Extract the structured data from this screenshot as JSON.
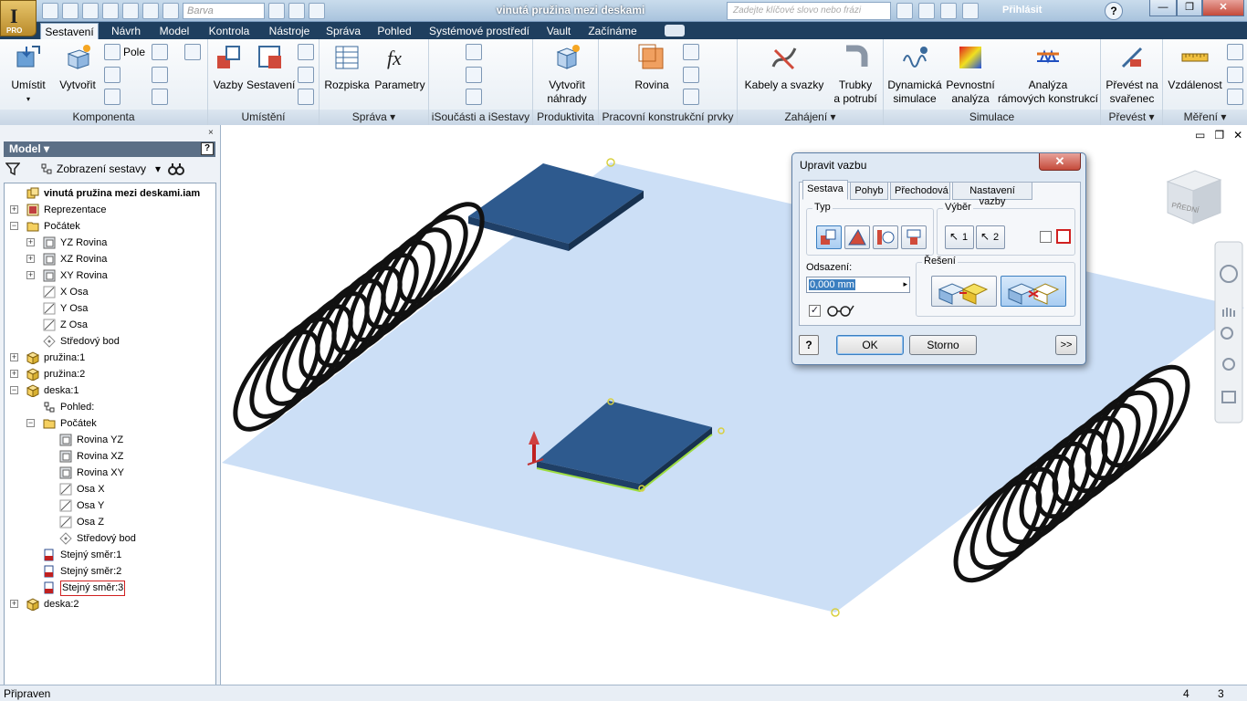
{
  "window": {
    "title": "vinutá pružina mezi deskami",
    "app_logo_text": "I",
    "app_badge": "PRO",
    "material_placeholder": "Barva",
    "search_placeholder": "Zadejte klíčové slovo nebo frázi",
    "signin": "Přihlásit",
    "help": "?"
  },
  "ribbon_tabs": [
    "Sestavení",
    "Návrh",
    "Model",
    "Kontrola",
    "Nástroje",
    "Správa",
    "Pohled",
    "Systémové prostředí",
    "Vault",
    "Začínáme"
  ],
  "ribbon": {
    "komponenta": {
      "label": "Komponenta",
      "umistit": "Umístit",
      "vytvorit": "Vytvořit",
      "pole": "Pole"
    },
    "umisteni": {
      "label": "Umístění",
      "vazby": "Vazby",
      "sestaveni": "Sestavení"
    },
    "sprava": {
      "label": "Správa",
      "rozpiska": "Rozpiska",
      "parametry": "Parametry"
    },
    "isoucasti": {
      "label": "iSoučásti a iSestavy"
    },
    "produktivita": {
      "label": "Produktivita",
      "vytvorit_nahrady_1": "Vytvořit",
      "vytvorit_nahrady_2": "náhrady"
    },
    "pracovni": {
      "label": "Pracovní konstrukční prvky",
      "rovina": "Rovina"
    },
    "zahajeni": {
      "label": "Zahájení",
      "kabely": "Kabely a svazky",
      "trubky_1": "Trubky",
      "trubky_2": "a potrubí"
    },
    "simulace": {
      "label": "Simulace",
      "dyn_1": "Dynamická",
      "dyn_2": "simulace",
      "pev_1": "Pevnostní",
      "pev_2": "analýza",
      "ana_1": "Analýza",
      "ana_2": "rámových konstrukcí"
    },
    "prevest": {
      "label": "Převést",
      "pn_1": "Převést na",
      "pn_2": "svařenec"
    },
    "mereni": {
      "label": "Měření",
      "vzdalenost": "Vzdálenost"
    }
  },
  "browser": {
    "title": "Model",
    "view": "Zobrazení sestavy",
    "close": "×",
    "help": "?",
    "tree": [
      {
        "text": "vinutá pružina mezi deskami.iam",
        "level": 0,
        "exp": "",
        "icon": "assembly",
        "bold": true
      },
      {
        "text": "Reprezentace",
        "level": 0,
        "exp": "+",
        "icon": "representations"
      },
      {
        "text": "Počátek",
        "level": 0,
        "exp": "−",
        "icon": "folder"
      },
      {
        "text": "YZ Rovina",
        "level": 1,
        "exp": "+",
        "icon": "plane"
      },
      {
        "text": "XZ Rovina",
        "level": 1,
        "exp": "+",
        "icon": "plane"
      },
      {
        "text": "XY Rovina",
        "level": 1,
        "exp": "+",
        "icon": "plane"
      },
      {
        "text": "X Osa",
        "level": 1,
        "exp": "",
        "icon": "axis"
      },
      {
        "text": "Y Osa",
        "level": 1,
        "exp": "",
        "icon": "axis"
      },
      {
        "text": "Z Osa",
        "level": 1,
        "exp": "",
        "icon": "axis"
      },
      {
        "text": "Středový bod",
        "level": 1,
        "exp": "",
        "icon": "point"
      },
      {
        "text": "pružina:1",
        "level": 0,
        "exp": "+",
        "icon": "part"
      },
      {
        "text": "pružina:2",
        "level": 0,
        "exp": "+",
        "icon": "part"
      },
      {
        "text": "deska:1",
        "level": 0,
        "exp": "−",
        "icon": "part"
      },
      {
        "text": "Pohled:",
        "level": 1,
        "exp": "",
        "icon": "view"
      },
      {
        "text": "Počátek",
        "level": 1,
        "exp": "−",
        "icon": "folder"
      },
      {
        "text": "Rovina YZ",
        "level": 2,
        "exp": "",
        "icon": "plane"
      },
      {
        "text": "Rovina XZ",
        "level": 2,
        "exp": "",
        "icon": "plane"
      },
      {
        "text": "Rovina XY",
        "level": 2,
        "exp": "",
        "icon": "plane"
      },
      {
        "text": "Osa X",
        "level": 2,
        "exp": "",
        "icon": "axis"
      },
      {
        "text": "Osa Y",
        "level": 2,
        "exp": "",
        "icon": "axis"
      },
      {
        "text": "Osa Z",
        "level": 2,
        "exp": "",
        "icon": "axis"
      },
      {
        "text": "Středový bod",
        "level": 2,
        "exp": "",
        "icon": "point"
      },
      {
        "text": "Stejný směr:1",
        "level": 1,
        "exp": "",
        "icon": "constraint"
      },
      {
        "text": "Stejný směr:2",
        "level": 1,
        "exp": "",
        "icon": "constraint"
      },
      {
        "text": "Stejný směr:3",
        "level": 1,
        "exp": "",
        "icon": "constraint",
        "selected": true
      },
      {
        "text": "deska:2",
        "level": 0,
        "exp": "+",
        "icon": "part"
      }
    ]
  },
  "dialog": {
    "title": "Upravit vazbu",
    "close": "✕",
    "tabs": [
      "Sestava",
      "Pohyb",
      "Přechodová",
      "Nastavení vazby"
    ],
    "typ": "Typ",
    "vyber": "Výběr",
    "vyber1": "1",
    "vyber2": "2",
    "odsazeni": "Odsazení:",
    "offset_value": "0,000 mm",
    "reseni": "Řešení",
    "preview_checked": true,
    "ok": "OK",
    "storno": "Storno",
    "more": ">>",
    "help": "?"
  },
  "viewcube": {
    "face": "PŘEDNÍ"
  },
  "status": {
    "text": "Připraven",
    "n1": "4",
    "n2": "3"
  },
  "colors": {
    "plate": "#2e5a8e",
    "plane": "#c7dcf5",
    "spring": "#111111",
    "accent": "#3c7fc0"
  }
}
